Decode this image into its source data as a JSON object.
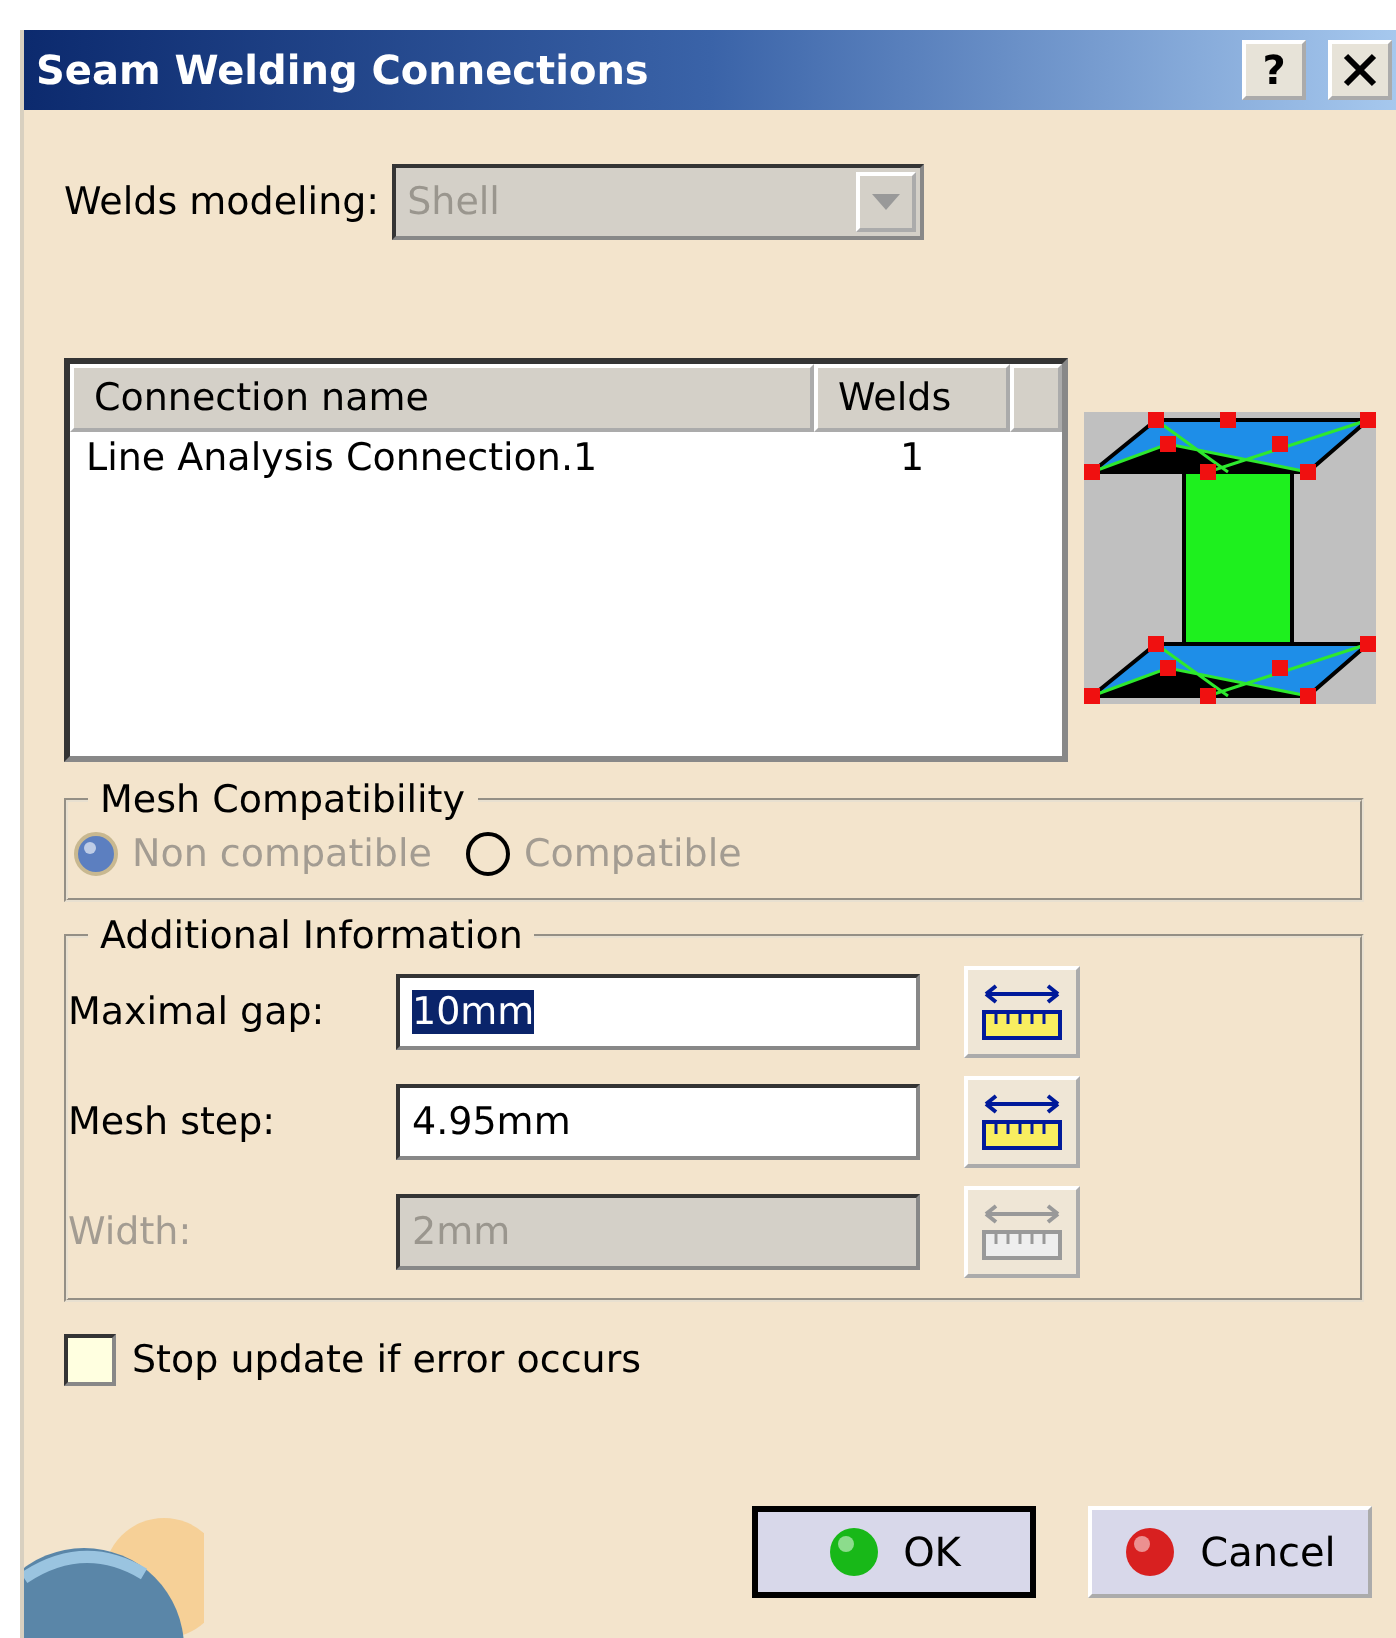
{
  "window": {
    "title": "Seam Welding Connections",
    "help": "?"
  },
  "welds_modeling": {
    "label": "Welds modeling:",
    "value": "Shell",
    "disabled": true
  },
  "table": {
    "columns": [
      "Connection name",
      "Welds"
    ],
    "rows": [
      {
        "cells": [
          "Line Analysis Connection.1",
          "1"
        ],
        "selected": false
      }
    ]
  },
  "mesh_compatibility": {
    "title": "Mesh Compatibility",
    "options": [
      {
        "label": "Non compatible",
        "selected": true,
        "disabled": true
      },
      {
        "label": "Compatible",
        "selected": false,
        "disabled": true
      }
    ]
  },
  "additional_information": {
    "title": "Additional Information",
    "fields": [
      {
        "label": "Maximal gap:",
        "value": "10mm",
        "disabled": false,
        "text_selected": true
      },
      {
        "label": "Mesh step:",
        "value": "4.95mm",
        "disabled": false,
        "text_selected": false
      },
      {
        "label": "Width:",
        "value": "2mm",
        "disabled": true,
        "text_selected": false
      }
    ]
  },
  "stop_update": {
    "label": "Stop update if error occurs",
    "checked": false
  },
  "buttons": [
    {
      "label": "OK",
      "kind": "ok",
      "default": true
    },
    {
      "label": "Cancel",
      "kind": "cancel",
      "default": false
    }
  ]
}
